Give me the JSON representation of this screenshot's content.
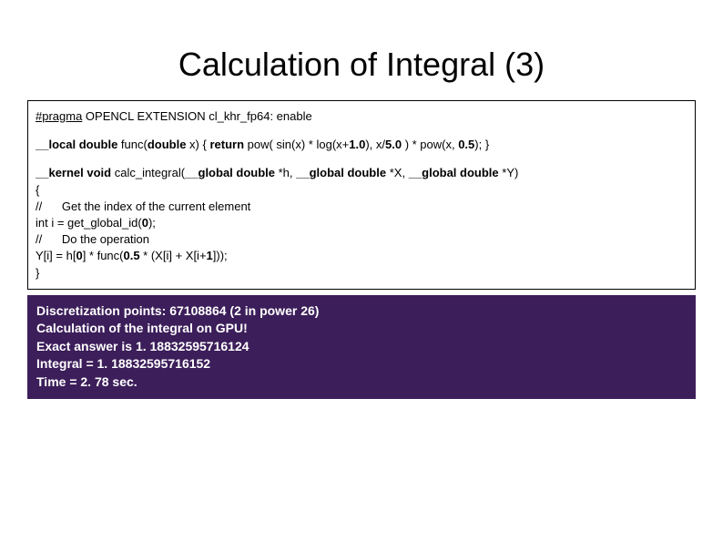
{
  "title": "Calculation of Integral (3)",
  "code": {
    "line1_pre": "#pragma",
    "line1_rest": " OPENCL EXTENSION cl_khr_fp64: enable",
    "line2_a": "__local double ",
    "line2_b": "func(",
    "line2_c": "double ",
    "line2_d": "x) { ",
    "line2_e": "return ",
    "line2_f": "pow( sin(x) * log(x+",
    "line2_g": "1.0",
    "line2_h": "), x/",
    "line2_i": "5.0 ",
    "line2_j": ") * pow(x, ",
    "line2_k": "0.5",
    "line2_l": "); }",
    "line3_a": "__kernel void ",
    "line3_b": "calc_integral(",
    "line3_c": "__global double ",
    "line3_d": "*h, ",
    "line3_e": "__global double ",
    "line3_f": "*X, ",
    "line3_g": "__global double ",
    "line3_h": "*Y)",
    "line4": "{",
    "line5": "//      Get the index of the current element",
    "line6_a": "int i = get_global_id(",
    "line6_b": "0",
    "line6_c": ");",
    "line7": "//      Do the operation",
    "line8_a": "Y[i] = h[",
    "line8_b": "0",
    "line8_c": "] * func(",
    "line8_d": "0.5 ",
    "line8_e": "* (X[i] + X[i+",
    "line8_f": "1",
    "line8_g": "]));",
    "line9": "}"
  },
  "output": {
    "l1": "Discretization points: 67108864 (2 in power 26)",
    "l2": "Calculation of the integral on GPU!",
    "l3": "Exact answer is 1. 18832595716124",
    "l4": "Integral =     1. 18832595716152",
    "l5": "Time = 2. 78 sec."
  }
}
